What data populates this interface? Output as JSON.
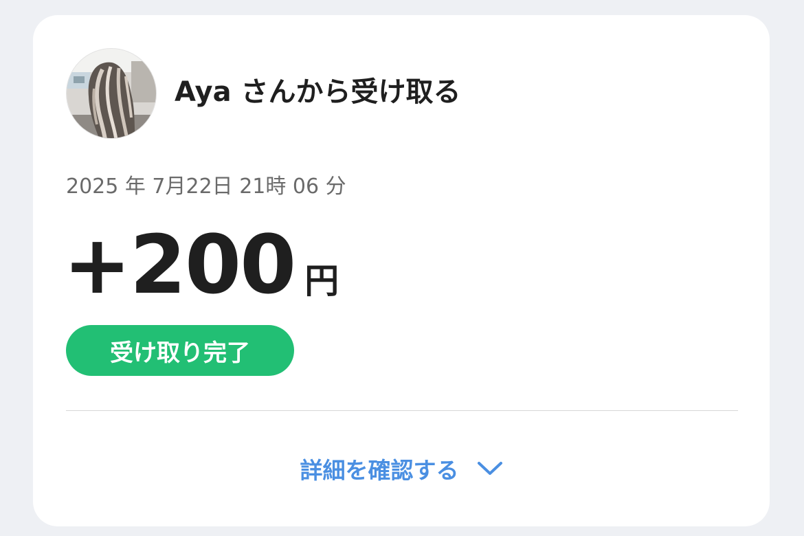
{
  "transaction": {
    "sender_title": "Aya さんから受け取る",
    "datetime": "2025 年 7月22日 21時 06 分",
    "amount": "+200",
    "currency_unit": "円",
    "status": "受け取り完了",
    "details_label": "詳細を確認する",
    "details_icon": "chevron-down-icon"
  },
  "colors": {
    "status_badge": "#22bf74",
    "link": "#4a8fe2",
    "background": "#eef0f4"
  }
}
